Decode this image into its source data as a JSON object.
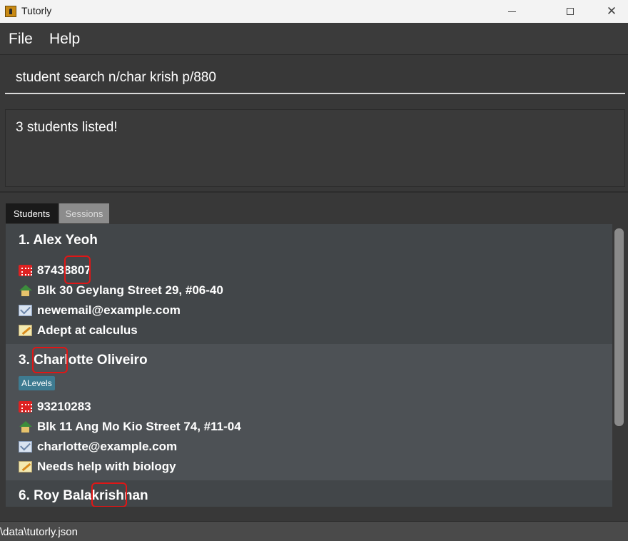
{
  "window": {
    "title": "Tutorly"
  },
  "menu": {
    "file": "File",
    "help": "Help"
  },
  "command": {
    "value": "student search n/char krish p/880",
    "placeholder": ""
  },
  "result": {
    "message": "3 students listed!"
  },
  "tabs": [
    {
      "label": "Students",
      "active": true
    },
    {
      "label": "Sessions",
      "active": false
    }
  ],
  "students": [
    {
      "name": "1. Alex Yeoh",
      "tags": [],
      "phone": "87438807",
      "address": "Blk 30 Geylang Street 29, #06-40",
      "email": "newemail@example.com",
      "note": "Adept at calculus"
    },
    {
      "name": "3. Charlotte Oliveiro",
      "tags": [
        "ALevels"
      ],
      "phone": "93210283",
      "address": "Blk 11 Ang Mo Kio Street 74, #11-04",
      "email": "charlotte@example.com",
      "note": "Needs help with biology"
    },
    {
      "name": "6. Roy Balakrishnan"
    }
  ],
  "status": {
    "path": "\\data\\tutorly.json"
  },
  "colors": {
    "highlight": "#e01616",
    "tag": "#3e7b91",
    "selected_card": "#4d5155"
  }
}
